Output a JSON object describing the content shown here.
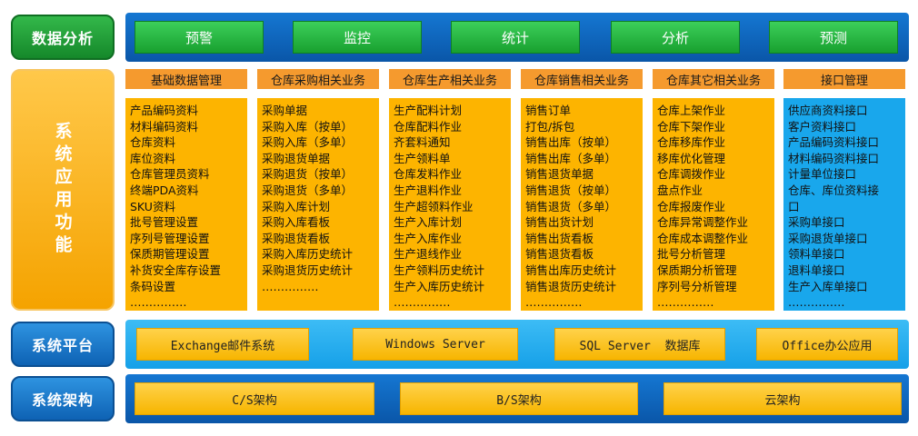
{
  "rows": {
    "analysis_label": "数据分析",
    "function_label": "系统应用功能",
    "platform_label": "系统平台",
    "arch_label": "系统架构"
  },
  "analysis_items": [
    "预警",
    "监控",
    "统计",
    "分析",
    "预测"
  ],
  "columns": [
    {
      "title": "基础数据管理",
      "items": [
        "产品编码资料",
        "材料编码资料",
        "仓库资料",
        "库位资料",
        "仓库管理员资料",
        "终端PDA资料",
        "SKU资料",
        "批号管理设置",
        "序列号管理设置",
        "保质期管理设置",
        "补货安全库存设置",
        "条码设置",
        "……………"
      ]
    },
    {
      "title": "仓库采购相关业务",
      "items": [
        "采购单据",
        "采购入库（按单）",
        "采购入库（多单）",
        "采购退货单据",
        "采购退货（按单）",
        "采购退货（多单）",
        "采购入库计划",
        "采购入库看板",
        "采购退货看板",
        "采购入库历史统计",
        "采购退货历史统计",
        "……………"
      ]
    },
    {
      "title": "仓库生产相关业务",
      "items": [
        "生产配料计划",
        "仓库配料作业",
        "齐套料通知",
        "生产领料单",
        "仓库发料作业",
        "生产退料作业",
        "生产超领料作业",
        "生产入库计划",
        "生产入库作业",
        "生产退线作业",
        "生产领料历史统计",
        "生产入库历史统计",
        "……………"
      ]
    },
    {
      "title": "仓库销售相关业务",
      "items": [
        "销售订单",
        "打包/拆包",
        "销售出库（按单）",
        "销售出库（多单）",
        "销售退货单据",
        "销售退货（按单）",
        "销售退货（多单）",
        "销售出货计划",
        "销售出货看板",
        "销售退货看板",
        "销售出库历史统计",
        "销售退货历史统计",
        "……………"
      ]
    },
    {
      "title": "仓库其它相关业务",
      "items": [
        "仓库上架作业",
        "仓库下架作业",
        "仓库移库作业",
        "移库优化管理",
        "仓库调拨作业",
        "盘点作业",
        "仓库报废作业",
        "仓库异常调整作业",
        "仓库成本调整作业",
        "批号分析管理",
        "保质期分析管理",
        "序列号分析管理",
        "……………"
      ]
    },
    {
      "title": "接口管理",
      "items": [
        "供应商资料接口",
        "客户资料接口",
        "产品编码资料接口",
        "材料编码资料接口",
        "计量单位接口",
        "仓库、库位资料接",
        "口",
        "采购单接口",
        "采购退货单接口",
        "领料单接口",
        "退料单接口",
        "生产入库单接口",
        "……………"
      ]
    }
  ],
  "platform_items": [
    "Exchange邮件系统",
    "Windows Server",
    "SQL Server  数据库",
    "Office办公应用"
  ],
  "arch_items": [
    "C/S架构",
    "B/S架构",
    "云架构"
  ]
}
